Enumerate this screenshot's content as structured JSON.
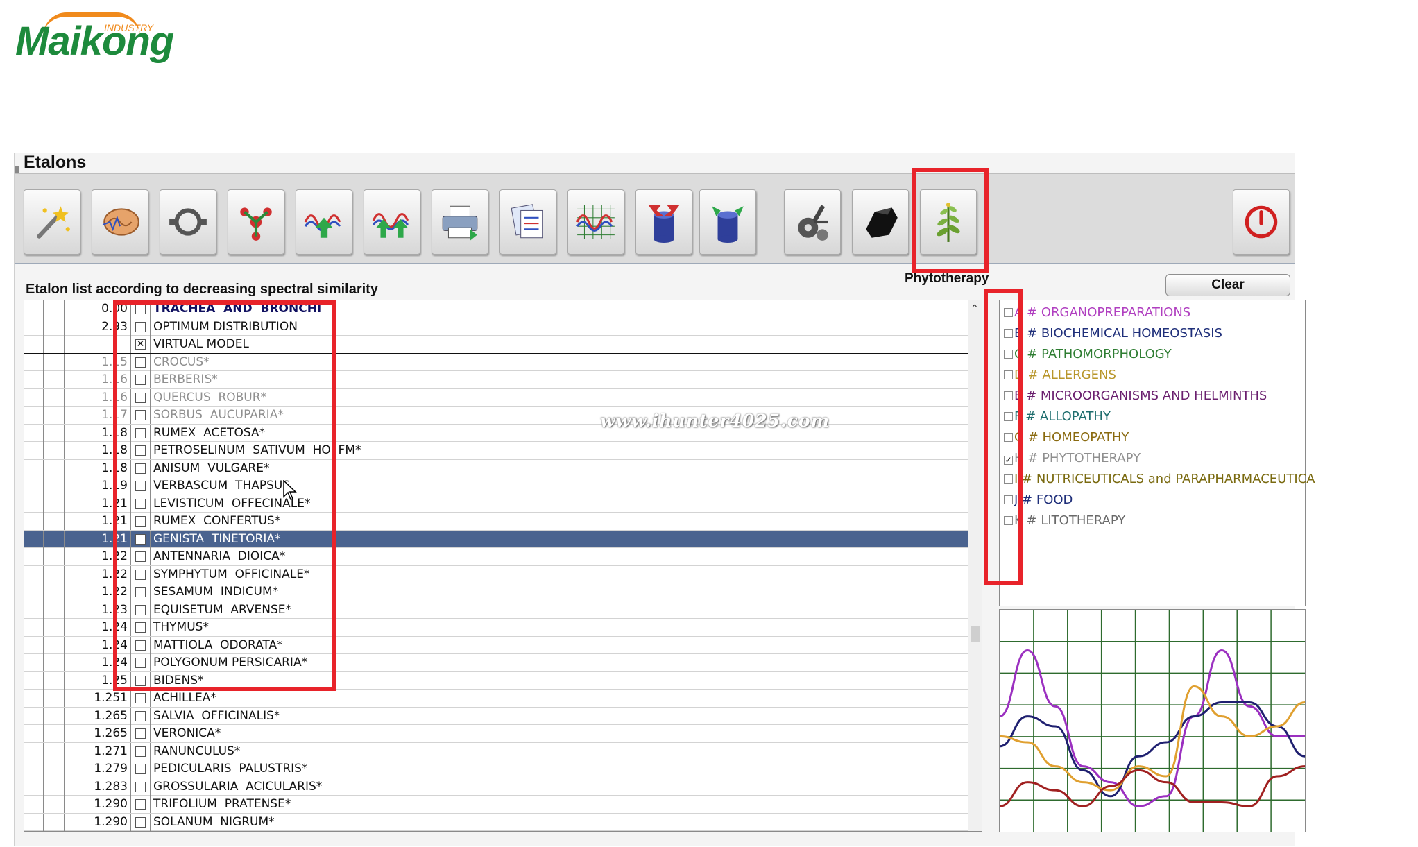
{
  "logo": {
    "brand": "Maikong",
    "sub": "INDUSTRY"
  },
  "window": {
    "title": "Etalons"
  },
  "toolbar": {
    "buttons": [
      {
        "icon": "magic-wand-icon"
      },
      {
        "icon": "brain-icon"
      },
      {
        "icon": "circuit-loop-icon"
      },
      {
        "icon": "molecule-icon"
      },
      {
        "icon": "wave-up-arrow-icon"
      },
      {
        "icon": "wave-double-arrow-icon"
      },
      {
        "icon": "printer-icon"
      },
      {
        "icon": "documents-icon"
      },
      {
        "icon": "spectrum-grid-icon"
      },
      {
        "icon": "cylinder-in-icon"
      },
      {
        "icon": "cylinder-out-icon"
      },
      {
        "icon": "gears-microscope-icon"
      },
      {
        "icon": "black-stone-icon"
      },
      {
        "icon": "plant-icon"
      }
    ],
    "active_caption": "Phytotherapy",
    "power_icon": "power-icon"
  },
  "list": {
    "heading": "Etalon list according to decreasing spectral similarity",
    "rows": [
      {
        "value": "0.00",
        "name": "TRACHEA  AND  BRONCHI",
        "checked": false,
        "style": "bold"
      },
      {
        "value": "2.93",
        "name": "OPTIMUM DISTRIBUTION",
        "checked": false,
        "style": "normal"
      },
      {
        "value": "",
        "name": "VIRTUAL MODEL",
        "checked": true,
        "style": "sep"
      },
      {
        "value": "1.15",
        "name": "CROCUS*",
        "checked": false,
        "style": "grey"
      },
      {
        "value": "1.16",
        "name": "BERBERIS*",
        "checked": false,
        "style": "grey"
      },
      {
        "value": "1.16",
        "name": "QUERCUS  ROBUR*",
        "checked": false,
        "style": "grey"
      },
      {
        "value": "1.17",
        "name": "SORBUS  AUCUPARIA*",
        "checked": false,
        "style": "grey"
      },
      {
        "value": "1.18",
        "name": "RUMEX  ACETOSA*",
        "checked": false,
        "style": "normal"
      },
      {
        "value": "1.18",
        "name": "PETROSELINUM  SATIVUM  HO  FM*",
        "checked": false,
        "style": "normal"
      },
      {
        "value": "1.18",
        "name": "ANISUM  VULGARE*",
        "checked": false,
        "style": "normal"
      },
      {
        "value": "1.19",
        "name": "VERBASCUM  THAPSUS",
        "checked": false,
        "style": "normal"
      },
      {
        "value": "1.21",
        "name": "LEVISTICUM  OFFECINALE*",
        "checked": false,
        "style": "normal"
      },
      {
        "value": "1.21",
        "name": "RUMEX  CONFERTUS*",
        "checked": false,
        "style": "normal"
      },
      {
        "value": "1.21",
        "name": "GENISTA  TINETORIA*",
        "checked": false,
        "style": "sel"
      },
      {
        "value": "1.22",
        "name": "ANTENNARIA  DIOICA*",
        "checked": false,
        "style": "normal"
      },
      {
        "value": "1.22",
        "name": "SYMPHYTUM  OFFICINALE*",
        "checked": false,
        "style": "normal"
      },
      {
        "value": "1.22",
        "name": "SESAMUM  INDICUM*",
        "checked": false,
        "style": "normal"
      },
      {
        "value": "1.23",
        "name": "EQUISETUM  ARVENSE*",
        "checked": false,
        "style": "normal"
      },
      {
        "value": "1.24",
        "name": "THYMUS*",
        "checked": false,
        "style": "normal"
      },
      {
        "value": "1.24",
        "name": "MATTIOLA  ODORATA*",
        "checked": false,
        "style": "normal"
      },
      {
        "value": "1.24",
        "name": "POLYGONUM PERSICARIA*",
        "checked": false,
        "style": "normal"
      },
      {
        "value": "1.25",
        "name": "BIDENS*",
        "checked": false,
        "style": "normal"
      },
      {
        "value": "1.251",
        "name": "ACHILLEA*",
        "checked": false,
        "style": "normal"
      },
      {
        "value": "1.265",
        "name": "SALVIA  OFFICINALIS*",
        "checked": false,
        "style": "normal"
      },
      {
        "value": "1.265",
        "name": "VERONICA*",
        "checked": false,
        "style": "normal"
      },
      {
        "value": "1.271",
        "name": "RANUNCULUS*",
        "checked": false,
        "style": "normal"
      },
      {
        "value": "1.279",
        "name": "PEDICULARIS  PALUSTRIS*",
        "checked": false,
        "style": "normal"
      },
      {
        "value": "1.283",
        "name": "GROSSULARIA  ACICULARIS*",
        "checked": false,
        "style": "normal"
      },
      {
        "value": "1.290",
        "name": "TRIFOLIUM  PRATENSE*",
        "checked": false,
        "style": "normal"
      },
      {
        "value": "1.290",
        "name": "SOLANUM  NIGRUM*",
        "checked": false,
        "style": "normal"
      }
    ]
  },
  "clear_label": "Clear",
  "categories": [
    {
      "letter": "A",
      "label": "ORGANOPREPARATIONS",
      "color": "#b03fc0",
      "checked": false
    },
    {
      "letter": "B",
      "label": "BIOCHEMICAL HOMEOSTASIS",
      "color": "#1f2f7a",
      "checked": false
    },
    {
      "letter": "C",
      "label": "PATHOMORPHOLOGY",
      "color": "#2e7d32",
      "checked": false
    },
    {
      "letter": "D",
      "label": "ALLERGENS",
      "color": "#b8962a",
      "checked": false
    },
    {
      "letter": "E",
      "label": "MICROORGANISMS AND HELMINTHS",
      "color": "#6a1f6e",
      "checked": false
    },
    {
      "letter": "F",
      "label": "ALLOPATHY",
      "color": "#1f6e6e",
      "checked": false
    },
    {
      "letter": "G",
      "label": "HOMEOPATHY",
      "color": "#8a6a10",
      "checked": false
    },
    {
      "letter": "H",
      "label": "PHYTOTHERAPY",
      "color": "#8f8f8f",
      "checked": true
    },
    {
      "letter": "I",
      "label": "NUTRICEUTICALS and PARAPHARMACEUTICA",
      "color": "#7a6a10",
      "checked": false
    },
    {
      "letter": "J",
      "label": "FOOD",
      "color": "#1f2f7a",
      "checked": false
    },
    {
      "letter": "K",
      "label": "LITOTHERAPY",
      "color": "#6a6a6a",
      "checked": false
    }
  ],
  "watermark": "www.ihunter4025.com",
  "chart_data": {
    "type": "line",
    "series": [
      {
        "color": "#9b30c0",
        "values": [
          0.55,
          0.88,
          0.6,
          0.3,
          0.22,
          0.1,
          0.15,
          0.55,
          0.88,
          0.6,
          0.45,
          0.45
        ]
      },
      {
        "color": "#1f2070",
        "values": [
          0.4,
          0.55,
          0.5,
          0.28,
          0.15,
          0.35,
          0.42,
          0.55,
          0.62,
          0.62,
          0.5,
          0.35
        ]
      },
      {
        "color": "#e0a030",
        "values": [
          0.45,
          0.42,
          0.3,
          0.22,
          0.18,
          0.3,
          0.25,
          0.7,
          0.55,
          0.45,
          0.5,
          0.62
        ]
      },
      {
        "color": "#a02020",
        "values": [
          0.1,
          0.22,
          0.18,
          0.1,
          0.2,
          0.28,
          0.22,
          0.12,
          0.12,
          0.1,
          0.25,
          0.3
        ]
      }
    ]
  }
}
